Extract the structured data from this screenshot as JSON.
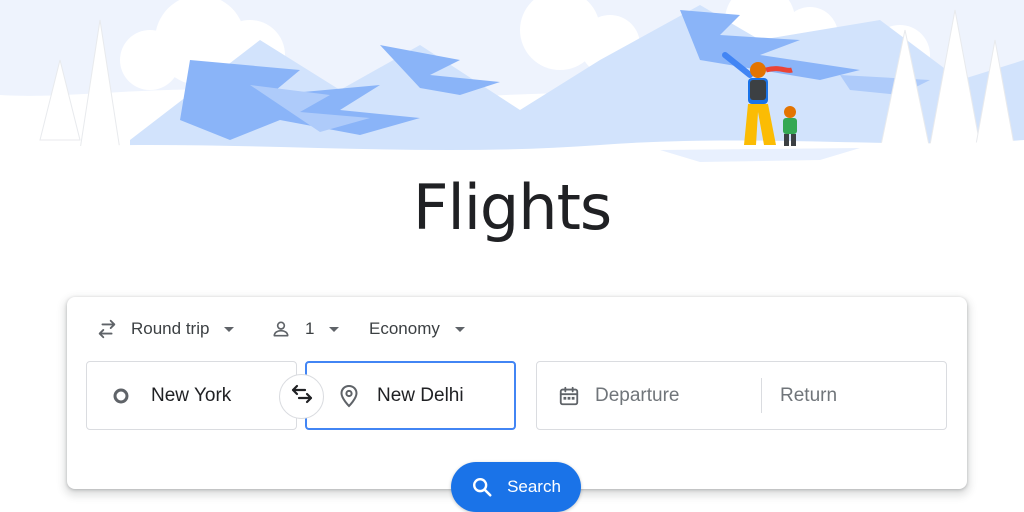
{
  "page": {
    "title": "Flights"
  },
  "options": {
    "trip_type": "Round trip",
    "passengers": "1",
    "cabin_class": "Economy"
  },
  "search": {
    "from_value": "New York",
    "to_value": "New Delhi",
    "departure_placeholder": "Departure",
    "return_placeholder": "Return",
    "button_label": "Search"
  },
  "icons": {
    "trip_type": "swap-horizontal-icon",
    "passengers": "person-icon",
    "dropdown": "arrow-drop-down-icon",
    "origin": "circle-outline-icon",
    "destination": "location-pin-icon",
    "swap": "swap-arrows-icon",
    "calendar": "calendar-icon",
    "search": "search-icon"
  },
  "colors": {
    "accent": "#1a73e8",
    "focus_border": "#4285f4",
    "illustration_blue": "#8ab4f8",
    "illustration_light": "#e8f0fe"
  }
}
